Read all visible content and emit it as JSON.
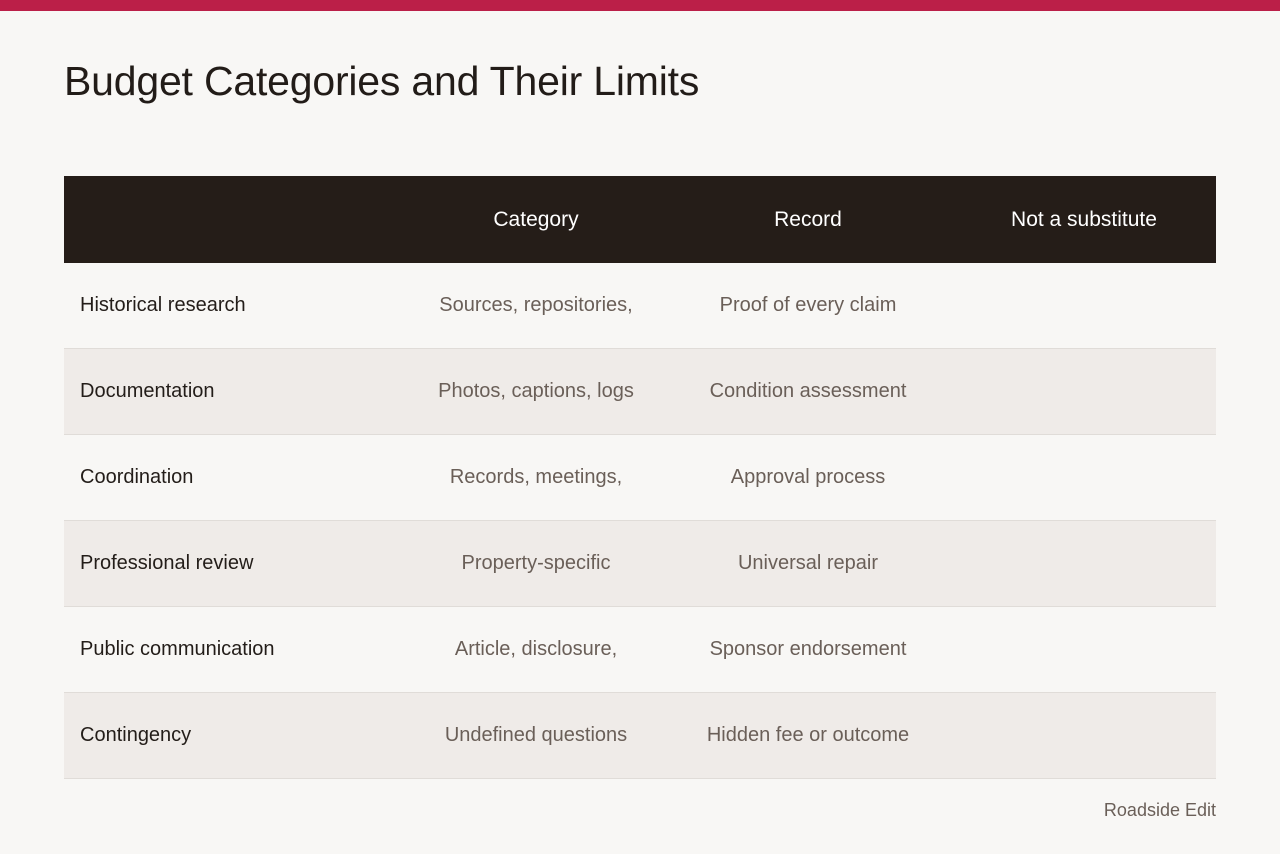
{
  "title": "Budget Categories and Their Limits",
  "colors": {
    "accent_bar": "#bb1f48",
    "header_bg": "#251d18",
    "row_alt_bg": "#efebe8",
    "page_bg": "#f8f7f5"
  },
  "table": {
    "headers": [
      "",
      "Category",
      "Record",
      "Not a substitute"
    ],
    "rows": [
      [
        "Historical research",
        "Sources, repositories,",
        "Proof of every claim",
        ""
      ],
      [
        "Documentation",
        "Photos, captions, logs",
        "Condition assessment",
        ""
      ],
      [
        "Coordination",
        "Records, meetings,",
        "Approval process",
        ""
      ],
      [
        "Professional review",
        "Property-specific",
        "Universal repair",
        ""
      ],
      [
        "Public communication",
        "Article, disclosure,",
        "Sponsor endorsement",
        ""
      ],
      [
        "Contingency",
        "Undefined questions",
        "Hidden fee or outcome",
        ""
      ]
    ]
  },
  "footer": "Roadside Edit"
}
